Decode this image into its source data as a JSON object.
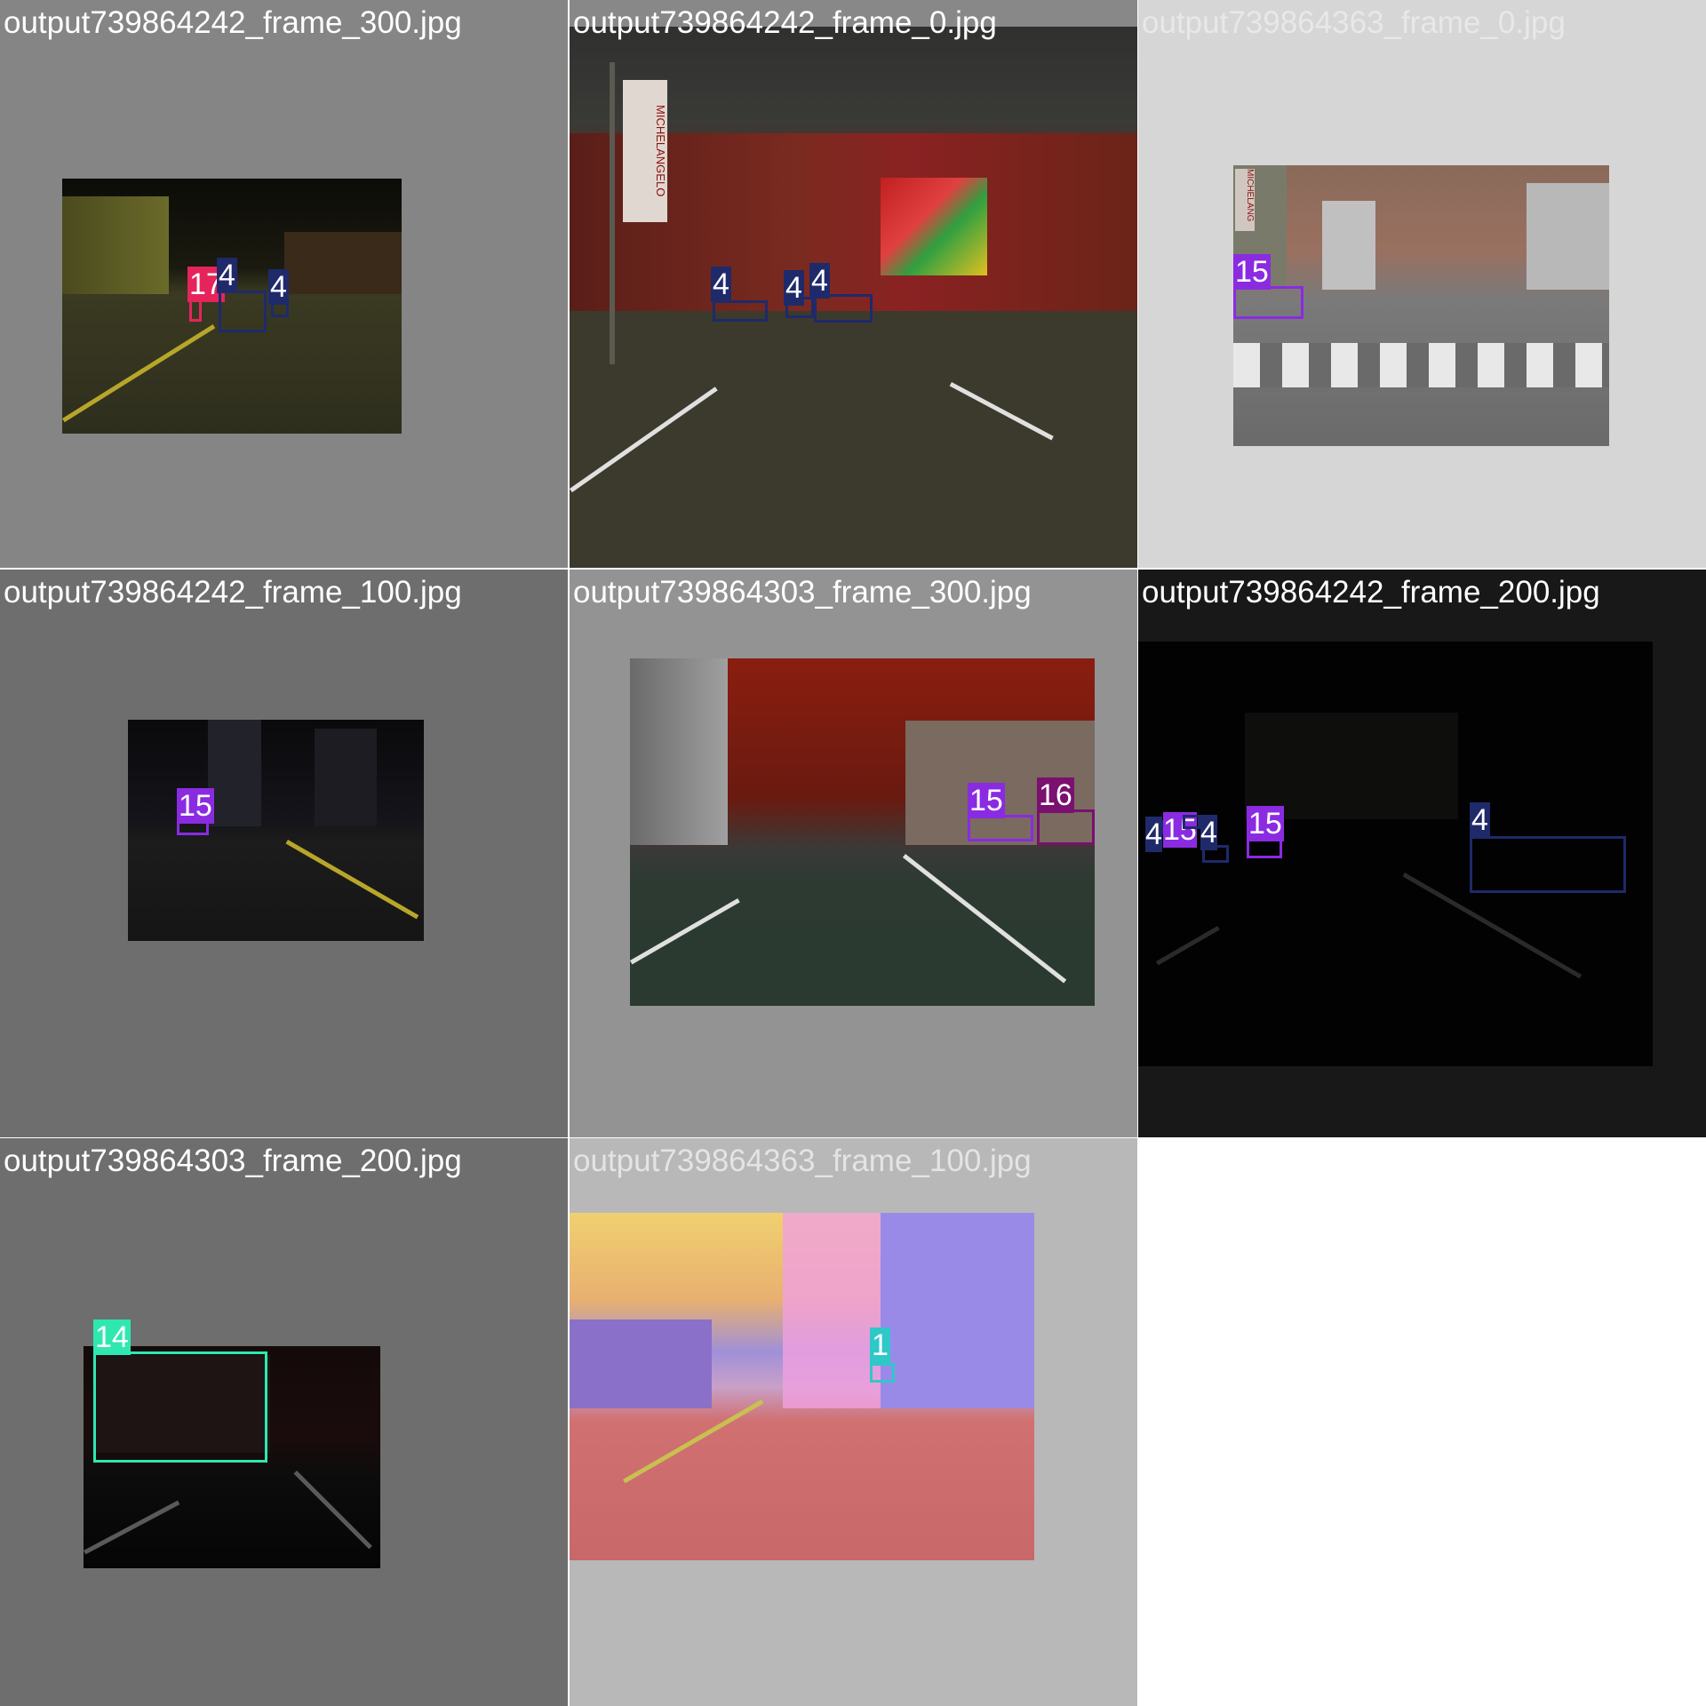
{
  "tiles": [
    {
      "title": "output739864242_frame_300.jpg",
      "labels": [
        "17",
        "4",
        "4"
      ]
    },
    {
      "title": "output739864242_frame_0.jpg",
      "labels": [
        "4",
        "4",
        "4"
      ],
      "sign_text": "MICHELANGELO"
    },
    {
      "title": "output739864363_frame_0.jpg",
      "labels": [
        "15"
      ],
      "sign_text": "MICHELANG"
    },
    {
      "title": "output739864242_frame_100.jpg",
      "labels": [
        "15"
      ]
    },
    {
      "title": "output739864303_frame_300.jpg",
      "labels": [
        "15",
        "16"
      ]
    },
    {
      "title": "output739864242_frame_200.jpg",
      "labels": [
        "4",
        "15",
        "4",
        "15",
        "4"
      ]
    },
    {
      "title": "output739864303_frame_200.jpg",
      "labels": [
        "14"
      ]
    },
    {
      "title": "output739864363_frame_100.jpg",
      "labels": [
        "1"
      ]
    }
  ],
  "colors": {
    "class_4": "#1f2a6b",
    "class_15": "#8a2be2",
    "class_16": "#7a1070",
    "class_17": "#e5245c",
    "class_14": "#2ee8b0",
    "class_1": "#2ec8c8"
  }
}
